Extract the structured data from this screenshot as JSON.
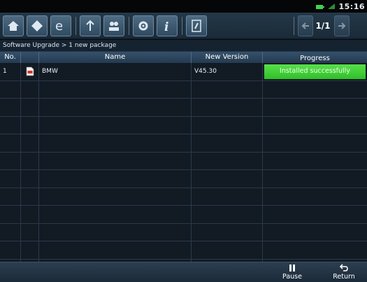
{
  "status": {
    "time": "15:16"
  },
  "toolbar": {
    "page": "1/1"
  },
  "breadcrumb": "Software Upgrade > 1 new package",
  "table": {
    "columns": [
      "No.",
      "",
      "Name",
      "New Version",
      "Progress"
    ],
    "rows": [
      {
        "no": "1",
        "name": "BMW",
        "version": "V45.30",
        "progress": "Installed successfully"
      }
    ]
  },
  "footer": {
    "pause_label": "Pause",
    "return_label": "Return"
  }
}
